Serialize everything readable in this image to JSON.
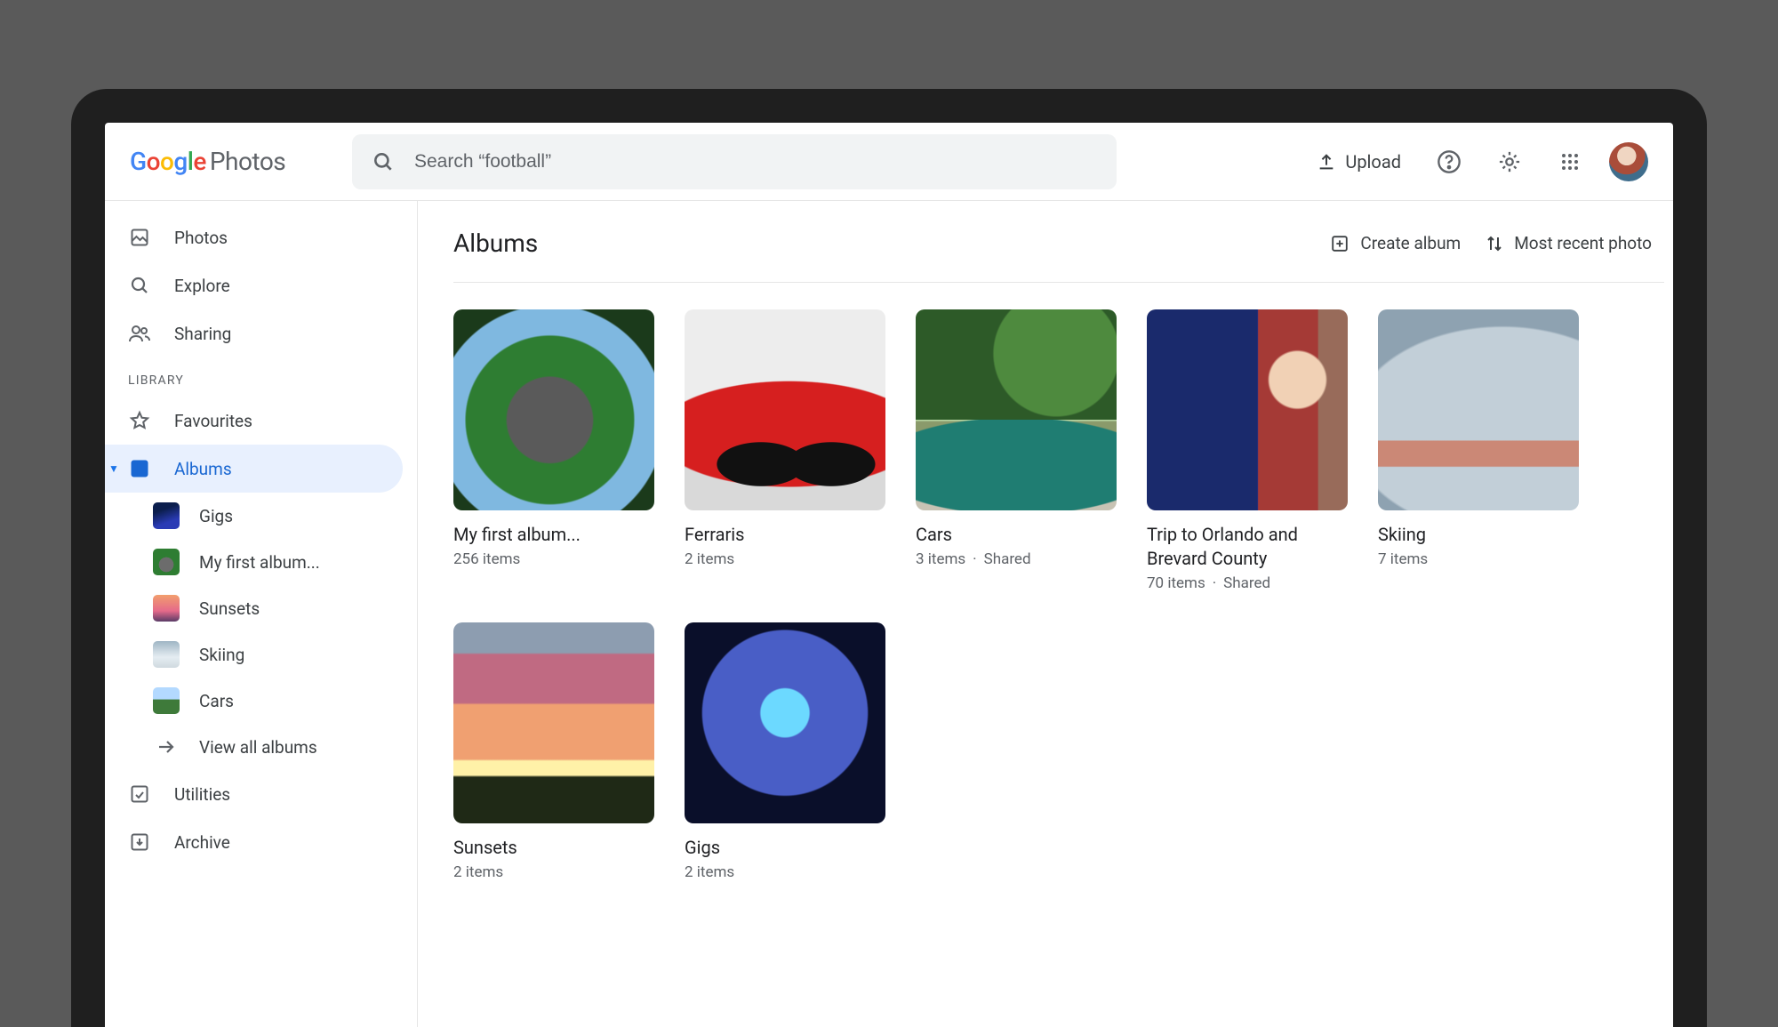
{
  "logo": {
    "brand_letters": [
      "G",
      "o",
      "o",
      "g",
      "l",
      "e"
    ],
    "product": "Photos"
  },
  "search": {
    "placeholder": "Search “football”"
  },
  "header_actions": {
    "upload": "Upload"
  },
  "sidebar": {
    "primary": [
      {
        "label": "Photos",
        "icon": "image"
      },
      {
        "label": "Explore",
        "icon": "search"
      },
      {
        "label": "Sharing",
        "icon": "people"
      }
    ],
    "section_label": "LIBRARY",
    "library": [
      {
        "label": "Favourites",
        "icon": "star"
      },
      {
        "label": "Albums",
        "icon": "album",
        "active": true,
        "children": [
          {
            "label": "Gigs",
            "thumb": "gigs"
          },
          {
            "label": "My first album...",
            "thumb": "myfirst"
          },
          {
            "label": "Sunsets",
            "thumb": "sunsets"
          },
          {
            "label": "Skiing",
            "thumb": "skiing"
          },
          {
            "label": "Cars",
            "thumb": "cars"
          }
        ],
        "view_all": "View all albums"
      },
      {
        "label": "Utilities",
        "icon": "utilities"
      },
      {
        "label": "Archive",
        "icon": "archive"
      }
    ]
  },
  "main": {
    "title": "Albums",
    "actions": {
      "create": "Create album",
      "sort": "Most recent photo"
    },
    "albums": [
      {
        "title": "My first album...",
        "meta": "256 items",
        "cover": "myfirst"
      },
      {
        "title": "Ferraris",
        "meta": "2 items",
        "cover": "ferraris"
      },
      {
        "title": "Cars",
        "meta": "3 items",
        "shared": "Shared",
        "cover": "cars"
      },
      {
        "title": "Trip to Orlando and Brevard County",
        "meta": "70 items",
        "shared": "Shared",
        "cover": "trip"
      },
      {
        "title": "Skiing",
        "meta": "7 items",
        "cover": "skiing"
      },
      {
        "title": "Sunsets",
        "meta": "2 items",
        "cover": "sunsets"
      },
      {
        "title": "Gigs",
        "meta": "2 items",
        "cover": "gigs"
      }
    ]
  }
}
